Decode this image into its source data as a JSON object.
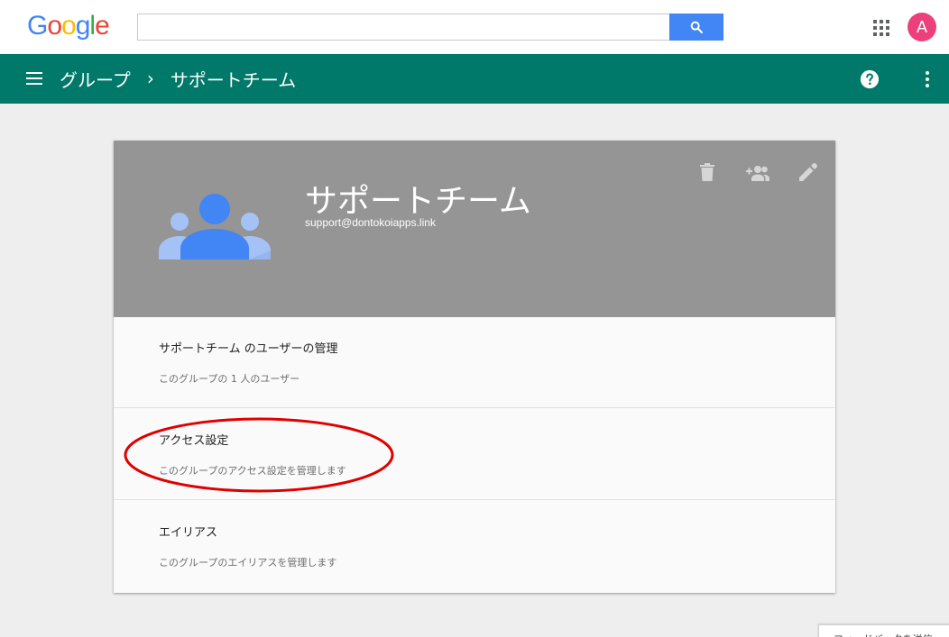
{
  "logo_letters": [
    "G",
    "o",
    "o",
    "g",
    "l",
    "e"
  ],
  "search": {
    "value": "",
    "placeholder": ""
  },
  "avatar_letter": "A",
  "breadcrumb": {
    "root": "グループ",
    "separator": "›",
    "current": "サポートチーム"
  },
  "group": {
    "name": "サポートチーム",
    "email": "support@dontokoiapps.link"
  },
  "sections": [
    {
      "title": "サポートチーム のユーザーの管理",
      "subtitle": "このグループの 1 人のユーザー"
    },
    {
      "title": "アクセス設定",
      "subtitle": "このグループのアクセス設定を管理します"
    },
    {
      "title": "エイリアス",
      "subtitle": "このグループのエイリアスを管理します"
    }
  ],
  "feedback_label": "フィードバックを送信",
  "colors": {
    "appbar": "#00796b",
    "search_button": "#4285f4",
    "avatar": "#ec407a",
    "card_header": "#959595",
    "highlight": "#e00000"
  },
  "icons": [
    "search-icon",
    "apps-icon",
    "menu-icon",
    "help-icon",
    "more-vert-icon",
    "delete-icon",
    "add-member-icon",
    "edit-icon",
    "group-avatar-icon"
  ]
}
